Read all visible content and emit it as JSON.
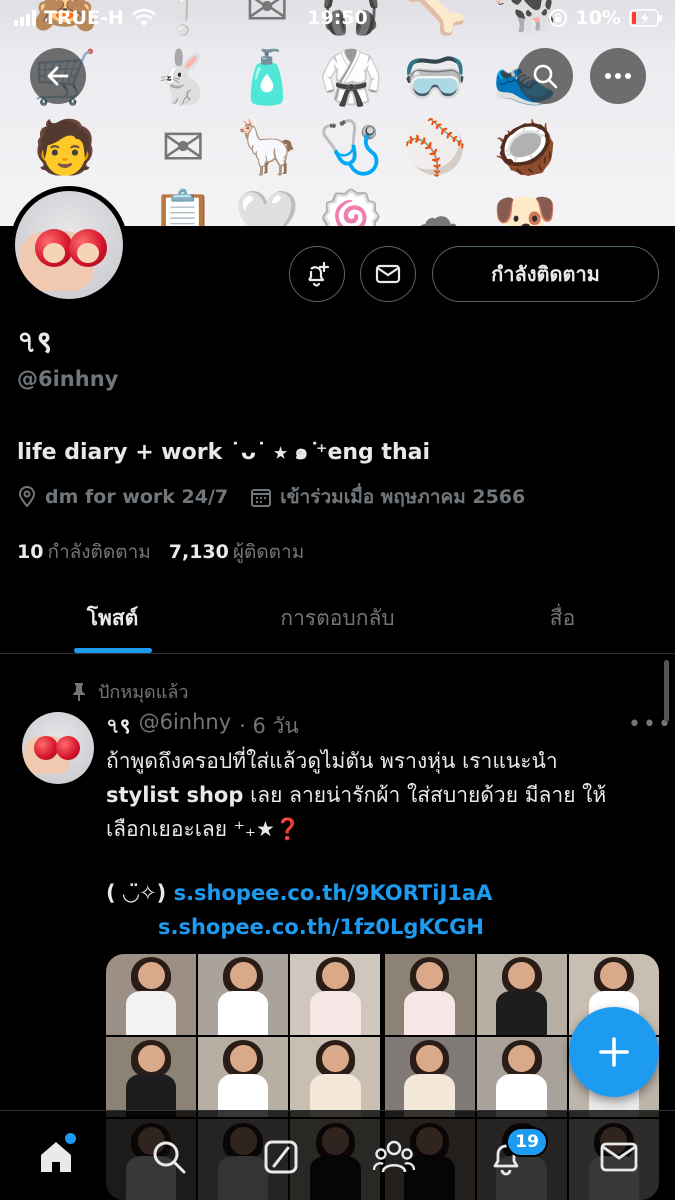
{
  "status_bar": {
    "carrier": "TRUE-H",
    "time": "19:50",
    "battery": "10%"
  },
  "banner": {
    "emojis": [
      "🙈",
      "❕",
      "✉",
      "🎧",
      "🦴",
      "🐄",
      "🛒",
      "🐇",
      "🧴",
      "🥋",
      "🥽",
      "👟",
      "🧑",
      "✉",
      "🦙",
      "🩺",
      "⚾",
      "🥥",
      "👀",
      "📋",
      "🤍",
      "🍥",
      "☁",
      "🐶"
    ]
  },
  "profile": {
    "display_name": "৭९",
    "handle": "@6inhny",
    "bio": "life diary + work ˙ᴗ˙ ⭒ ๑ ͘⁺eng thai",
    "location": "dm for work 24/7",
    "joined": "เข้าร่วมเมื่อ พฤษภาคม 2566",
    "following_count": "10",
    "following_label": "กำลังติดตาม",
    "followers_count": "7,130",
    "followers_label": "ผู้ติดตาม",
    "follow_button_label": "กำลังติดตาม"
  },
  "tabs": [
    "โพสต์",
    "การตอบกลับ",
    "สื่อ"
  ],
  "post": {
    "pinned_label": "ปักหมุดแล้ว",
    "name": "৭९",
    "handle": "@6inhny",
    "time": "· 6 วัน",
    "text_line1": "ถ้าพูดถึงครอปที่ใส่แล้วดูไม่ตัน พรางหุ่น เราแนะนำ",
    "text_bold": "stylist shop",
    "text_line2_rest": " เลย ลายน่ารักผ้า ใส่สบายด้วย มีลาย ให้",
    "text_line3": "เลือกเยอะเลย ⁺₊★❓",
    "link_prefix": "( ◡̈✧)",
    "link1": "s.shopee.co.th/9KORTiJ1aA",
    "link2": "s.shopee.co.th/1fz0LgKCGH"
  },
  "bottom_nav": {
    "notification_count": "19"
  }
}
